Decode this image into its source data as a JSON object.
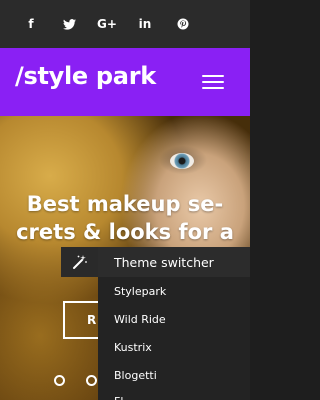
{
  "social": {
    "items": [
      {
        "label": "f",
        "icon": "facebook-icon"
      },
      {
        "label": "",
        "icon": "twitter-icon"
      },
      {
        "label": "G+",
        "icon": "google-plus-icon"
      },
      {
        "label": "in",
        "icon": "linkedin-icon"
      },
      {
        "label": "",
        "icon": "pinterest-icon"
      }
    ]
  },
  "header": {
    "logo": "/style park",
    "menu_icon": "hamburger-icon",
    "background": "#8a20f4"
  },
  "hero": {
    "title_line1": "Best makeup se-",
    "title_line2": "crets & looks for a",
    "button_label": "R",
    "slides": 2
  },
  "theme_switcher": {
    "icon": "magic-wand-icon",
    "title": "Theme switcher",
    "items": [
      "Stylepark",
      "Wild Ride",
      "Kustrix",
      "Blogetti",
      "Fl"
    ]
  }
}
